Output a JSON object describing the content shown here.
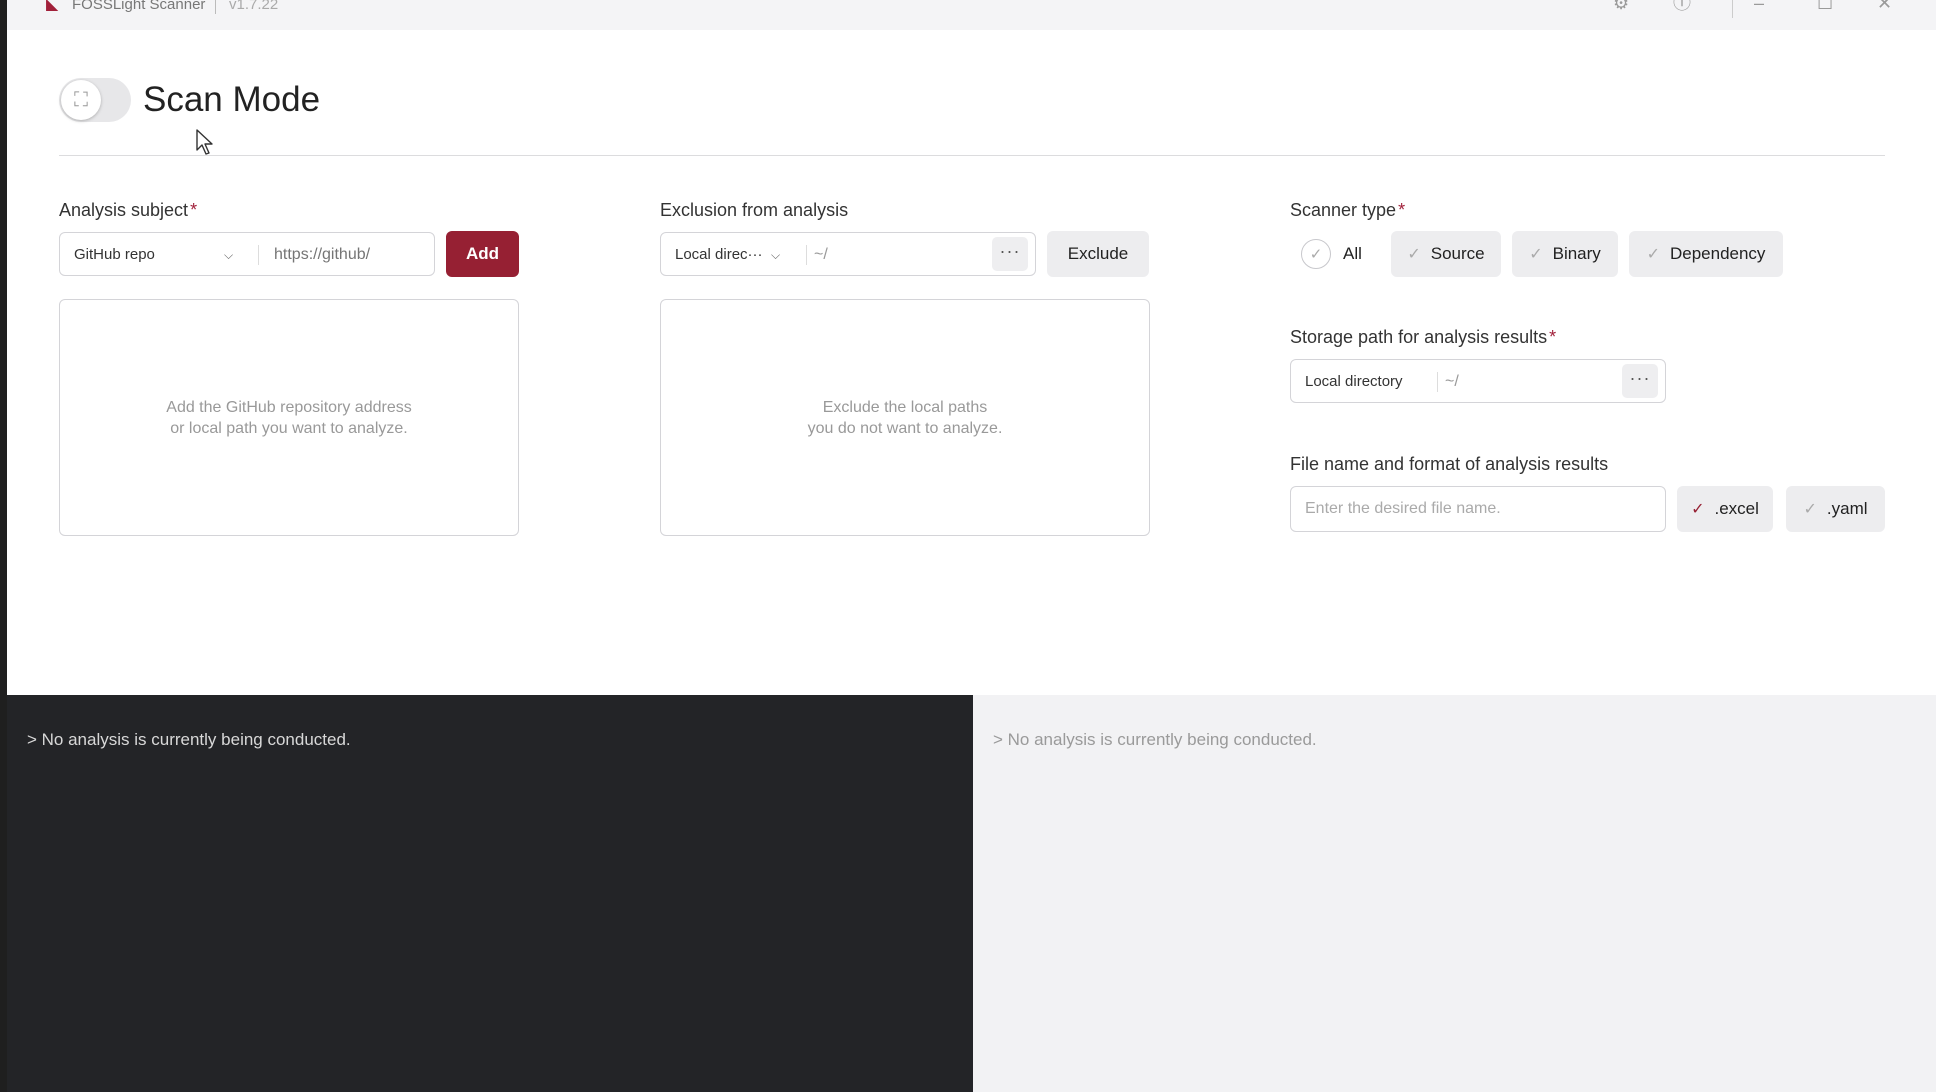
{
  "titlebar": {
    "app_name": "FOSSLight Scanner",
    "version": "v1.7.22",
    "icons": [
      "gear-icon",
      "info-icon",
      "minimize-icon",
      "maximize-icon",
      "close-icon"
    ]
  },
  "header": {
    "mode_title": "Scan Mode",
    "toggle_icon": "scan-frame-icon"
  },
  "analysis_subject": {
    "label": "Analysis subject",
    "required_mark": "*",
    "source_select": "GitHub repo",
    "url_placeholder": "https://github/",
    "add_label": "Add",
    "empty_hint_line1": "Add the GitHub repository address",
    "empty_hint_line2": "or local path you want to analyze."
  },
  "exclusion": {
    "label": "Exclusion from analysis",
    "source_select": "Local direc···",
    "path_value": "~/",
    "browse_label": "···",
    "exclude_label": "Exclude",
    "empty_hint_line1": "Exclude the local paths",
    "empty_hint_line2": "you do not want to analyze."
  },
  "scanner_type": {
    "label": "Scanner type",
    "required_mark": "*",
    "all_label": "All",
    "options": [
      "Source",
      "Binary",
      "Dependency"
    ]
  },
  "storage": {
    "label": "Storage path for analysis results",
    "required_mark": "*",
    "location": "Local directory",
    "path_value": "~/",
    "browse_label": "···"
  },
  "file_output": {
    "label": "File name and format of analysis results",
    "file_placeholder": "Enter the desired file name.",
    "formats": [
      {
        "label": ".excel",
        "selected": true
      },
      {
        "label": ".yaml",
        "selected": false
      }
    ]
  },
  "logs": {
    "left_status": "> No analysis is currently being conducted.",
    "right_status": "> No analysis is currently being conducted."
  },
  "colors": {
    "accent": "#962033",
    "log_dark_bg": "#232427",
    "log_light_bg": "#f2f2f4"
  }
}
